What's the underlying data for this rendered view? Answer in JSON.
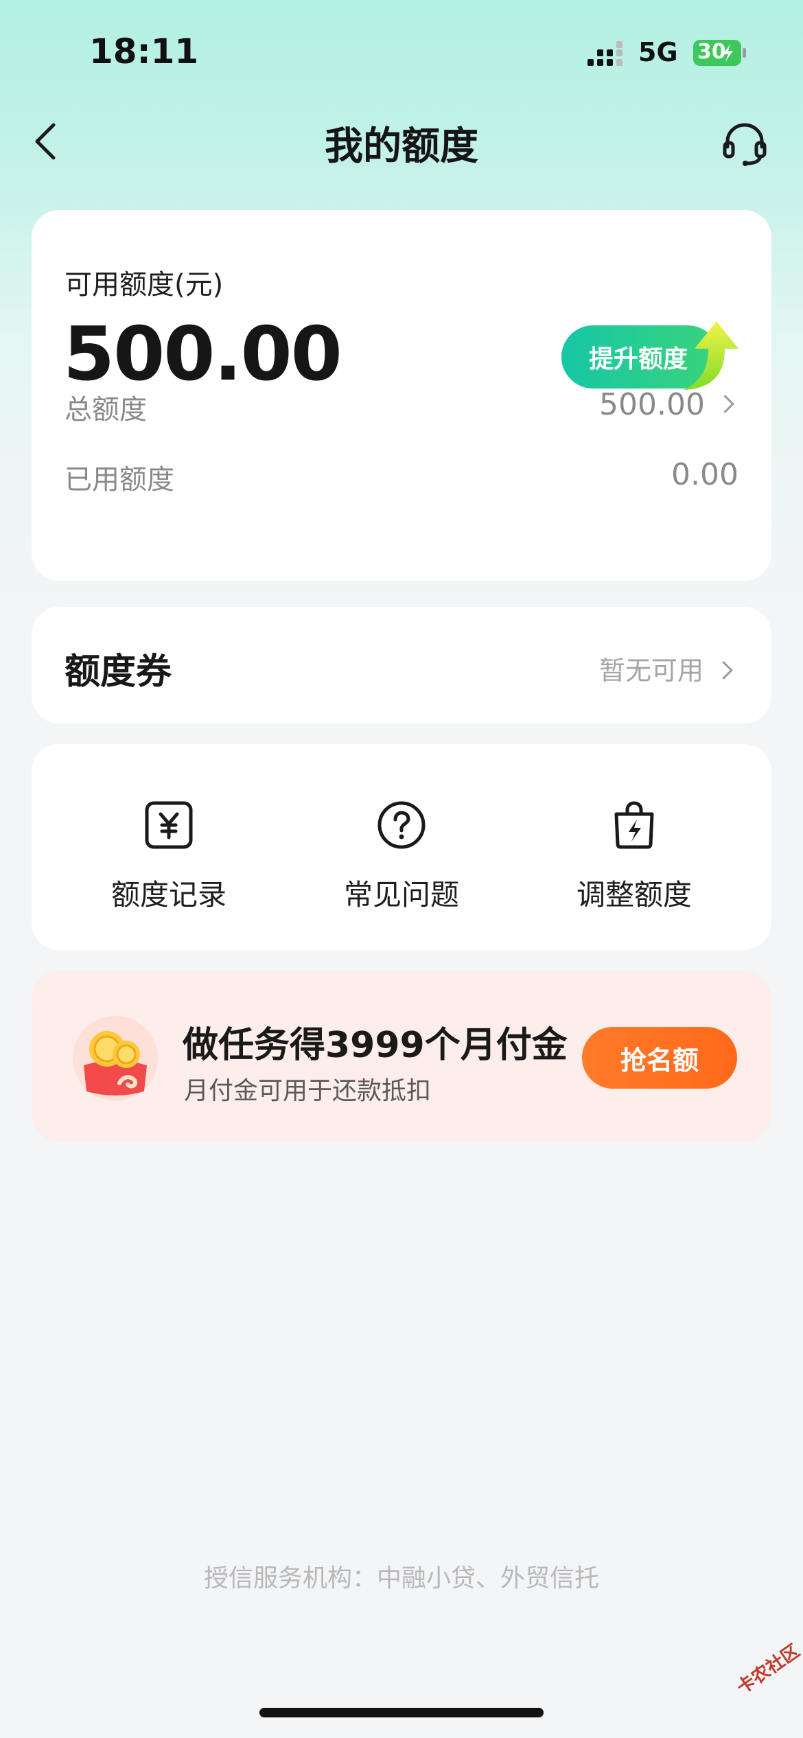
{
  "status_bar": {
    "time": "18:11",
    "network": "5G",
    "battery": "30"
  },
  "nav": {
    "title": "我的额度",
    "back_icon": "chevron-left-icon",
    "service_icon": "headset-icon"
  },
  "quota": {
    "available_label": "可用额度(元)",
    "available_amount": "500.00",
    "raise_button": "提升额度",
    "total_label": "总额度",
    "total_value": "500.00",
    "used_label": "已用额度",
    "used_value": "0.00"
  },
  "coupon": {
    "title": "额度券",
    "status": "暂无可用"
  },
  "tools": [
    {
      "label": "额度记录",
      "icon": "yuan-record-icon"
    },
    {
      "label": "常见问题",
      "icon": "question-circle-icon"
    },
    {
      "label": "调整额度",
      "icon": "lightning-bag-icon"
    }
  ],
  "promo": {
    "title": "做任务得3999个月付金",
    "subtitle": "月付金可用于还款抵扣",
    "button": "抢名额"
  },
  "footer": {
    "note": "授信服务机构：中融小贷、外贸信托"
  },
  "watermark": {
    "text": "卡农社区"
  },
  "colors": {
    "accent_green": "#16c7a6",
    "promo_orange": "#ff7a2a",
    "promo_bg": "#fdeeec",
    "header_gradient": "#b3f0e2"
  }
}
